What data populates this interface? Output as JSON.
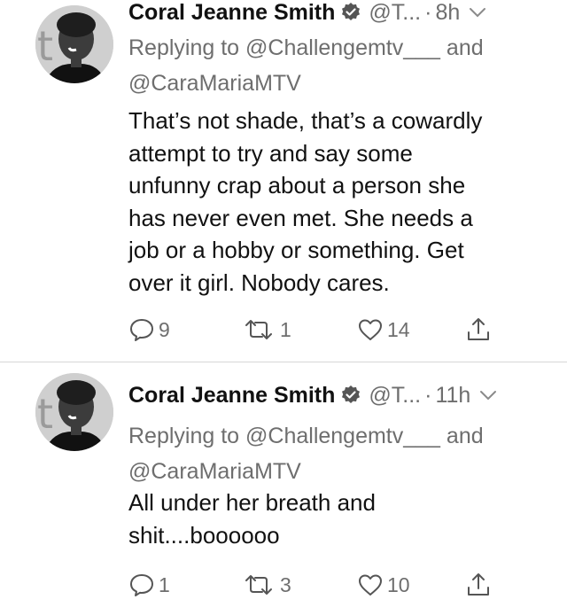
{
  "tweets": [
    {
      "author_name": "Coral Jeanne Smith",
      "handle": "@T...",
      "separator": "·",
      "time": "8h",
      "reply_prefix": "Replying to @Challengemtv___ and",
      "reply_second": "@CaraMariaMTV",
      "text": "That’s not shade, that’s a cowardly\nattempt to try and say some\nunfunny crap about a person she\nhas never even met. She needs a\njob or a hobby or something. Get\nover it girl. Nobody cares.",
      "replies": "9",
      "retweets": "1",
      "likes": "14"
    },
    {
      "author_name": "Coral Jeanne Smith",
      "handle": "@T...",
      "separator": "·",
      "time": "11h",
      "reply_prefix": "Replying to @Challengemtv___ and",
      "reply_second": "@CaraMariaMTV",
      "text": "All under her breath and\nshit....boooooo",
      "replies": "1",
      "retweets": "3",
      "likes": "10"
    }
  ],
  "icons": {
    "verified": "verified-badge-icon",
    "menu": "chevron-down-icon",
    "reply": "reply-bubble-icon",
    "retweet": "retweet-icon",
    "like": "heart-icon",
    "share": "share-icon"
  },
  "colors": {
    "text": "#111111",
    "muted": "#6e6e6e",
    "divider": "#d6d6d6"
  }
}
